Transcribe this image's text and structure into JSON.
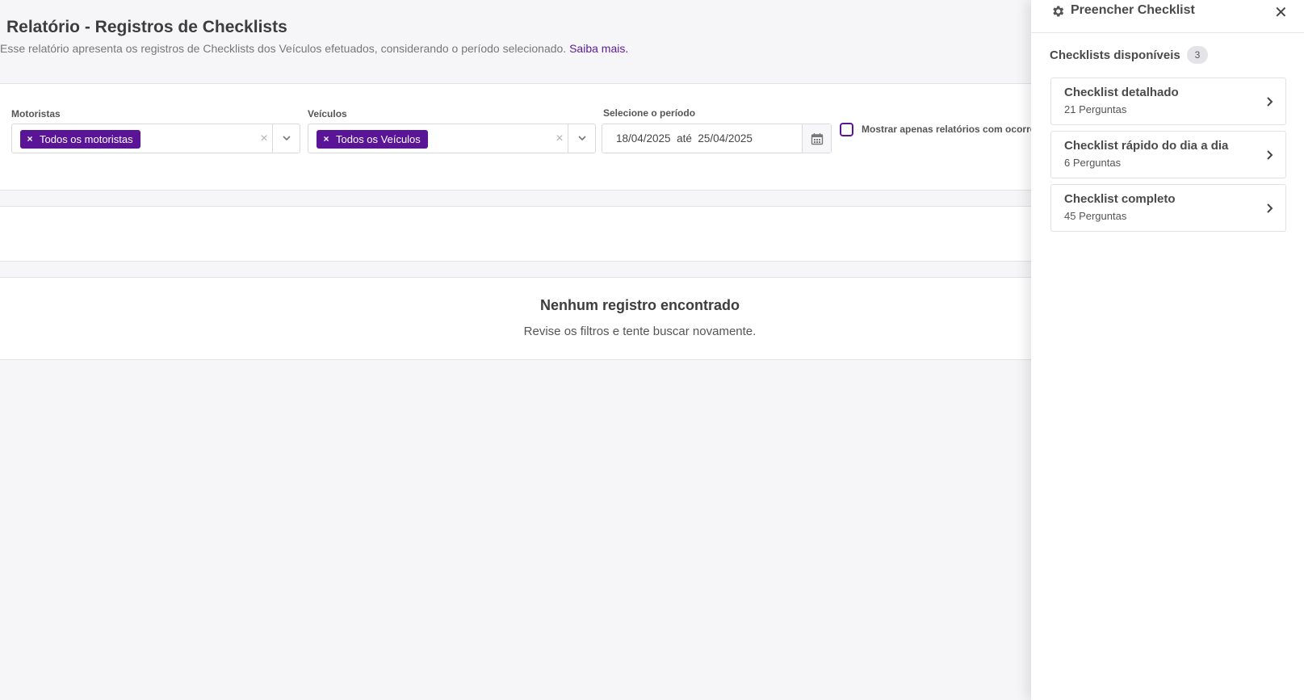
{
  "header": {
    "title": "Relatório - Registros de Checklists",
    "description": "Esse relatório apresenta os registros de Checklists dos Veículos efetuados, considerando o período selecionado.",
    "learn_more": "Saiba mais."
  },
  "filters": {
    "drivers": {
      "label": "Motoristas",
      "chip": "Todos os motoristas",
      "chip_remove": "×",
      "clear": "×"
    },
    "vehicles": {
      "label": "Veículos",
      "chip": "Todos os Veículos",
      "chip_remove": "×",
      "clear": "×"
    },
    "period": {
      "label": "Selecione o período",
      "value": "18/04/2025  até  25/04/2025"
    },
    "only_occurrences": {
      "label": "Mostrar apenas relatórios com ocorrências",
      "checked": false
    }
  },
  "empty_state": {
    "title": "Nenhum registro encontrado",
    "subtitle": "Revise os filtros e tente buscar novamente."
  },
  "panel": {
    "title": "Preencher Checklist",
    "close": "✕",
    "available_label": "Checklists disponíveis",
    "available_count": "3",
    "items": [
      {
        "title": "Checklist detalhado",
        "subtitle": "21 Perguntas"
      },
      {
        "title": "Checklist rápido do dia a dia",
        "subtitle": "6 Perguntas"
      },
      {
        "title": "Checklist completo",
        "subtitle": "45 Perguntas"
      }
    ]
  },
  "colors": {
    "accent": "#5a1597",
    "link": "#5b1a98",
    "background": "#f6f6f8"
  },
  "icons": [
    "gear-icon",
    "close-icon",
    "chevron-down-icon",
    "calendar-icon",
    "chevron-right-icon"
  ]
}
